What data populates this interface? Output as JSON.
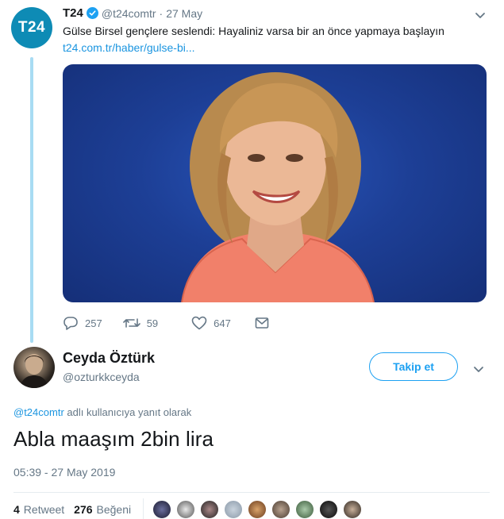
{
  "parent_tweet": {
    "avatar_text": "T24",
    "author_name": "T24",
    "author_handle": "@t24comtr",
    "separator": "·",
    "date": "27 May",
    "text": "Gülse Birsel gençlere seslendi: Hayaliniz varsa bir an önce yapmaya başlayın",
    "link": "t24.com.tr/haber/gulse-bi...",
    "actions": {
      "reply_count": "257",
      "retweet_count": "59",
      "like_count": "647"
    }
  },
  "reply_tweet": {
    "author_name": "Ceyda Öztürk",
    "author_handle": "@ozturkkceyda",
    "follow_label": "Takip et",
    "context_mention": "@t24comtr",
    "context_text": " adlı kullanıcıya yanıt olarak",
    "text": "Abla maaşım 2bin lira",
    "timestamp": "05:39 - 27 May 2019",
    "stats": {
      "retweet_count": "4",
      "retweet_label": "Retweet",
      "like_count": "276",
      "like_label": "Beğeni"
    }
  },
  "colors": {
    "accent": "#1da1f2",
    "link": "#1b95e0",
    "muted": "#657786",
    "thread_line": "#a8dcf3",
    "t24_brand": "#0e8bb5"
  },
  "icons": [
    "verified-badge-icon",
    "chevron-down-icon",
    "reply-icon",
    "retweet-icon",
    "like-icon",
    "message-icon"
  ]
}
